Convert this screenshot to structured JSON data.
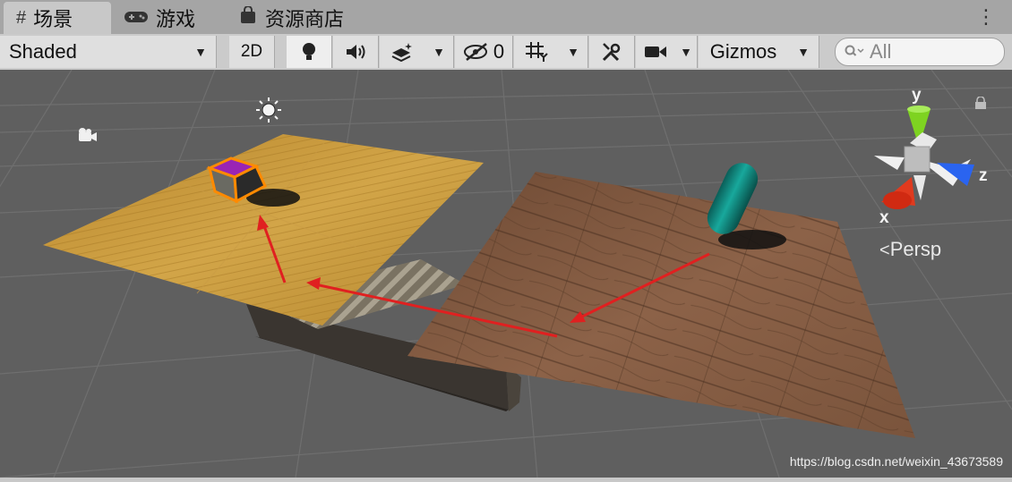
{
  "tabs": [
    {
      "label": "场景",
      "icon": "grid-hash-icon",
      "active": true
    },
    {
      "label": "游戏",
      "icon": "gamepad-icon",
      "active": false
    },
    {
      "label": "资源商店",
      "icon": "shopping-bag-icon",
      "active": false
    }
  ],
  "toolbar": {
    "shading_mode": "Shaded",
    "two_d_label": "2D",
    "hidden_count": "0",
    "gizmos_label": "Gizmos",
    "search_placeholder": "All"
  },
  "scene": {
    "camera_mode": "Persp",
    "axis_labels": {
      "x": "x",
      "y": "y",
      "z": "z"
    }
  },
  "watermark": "https://blog.csdn.net/weixin_43673589",
  "colors": {
    "viewport_bg": "#5f5f5f",
    "grid_line": "#6e6e6e",
    "light_wood": "#c89a3a",
    "dark_wood": "#7a5238",
    "arrow_red": "#e02020",
    "cube_purple": "#8a14a0",
    "capsule_teal": "#0e8a82",
    "axis_y": "#7ed321",
    "axis_x": "#e03a1e",
    "axis_z": "#2a64f0"
  }
}
